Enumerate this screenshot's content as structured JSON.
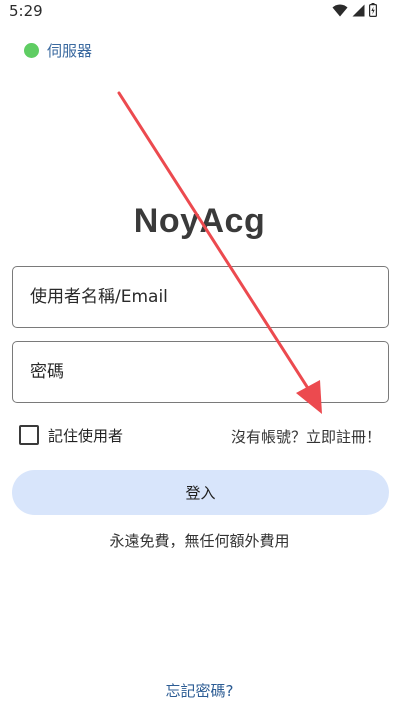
{
  "status_bar": {
    "time": "5:29",
    "icons": [
      "wifi-icon",
      "cellular-signal-icon",
      "battery-icon"
    ]
  },
  "server": {
    "label": "伺服器",
    "status_color": "#5fcd63",
    "label_color": "#3b6aa0"
  },
  "logo": {
    "text": "NoyAcg"
  },
  "form": {
    "username_placeholder": "使用者名稱/Email",
    "password_placeholder": "密碼"
  },
  "remember": {
    "label": "記住使用者",
    "checked": false
  },
  "register_link": "沒有帳號？立即註冊！",
  "login_button": {
    "label": "登入",
    "background": "#d8e5fb"
  },
  "free_note": "永遠免費，無任何額外費用",
  "forgot_link": {
    "label": "忘記密碼?",
    "color": "#2c5c94"
  },
  "annotation": {
    "arrow_color": "#ec4a4f"
  }
}
